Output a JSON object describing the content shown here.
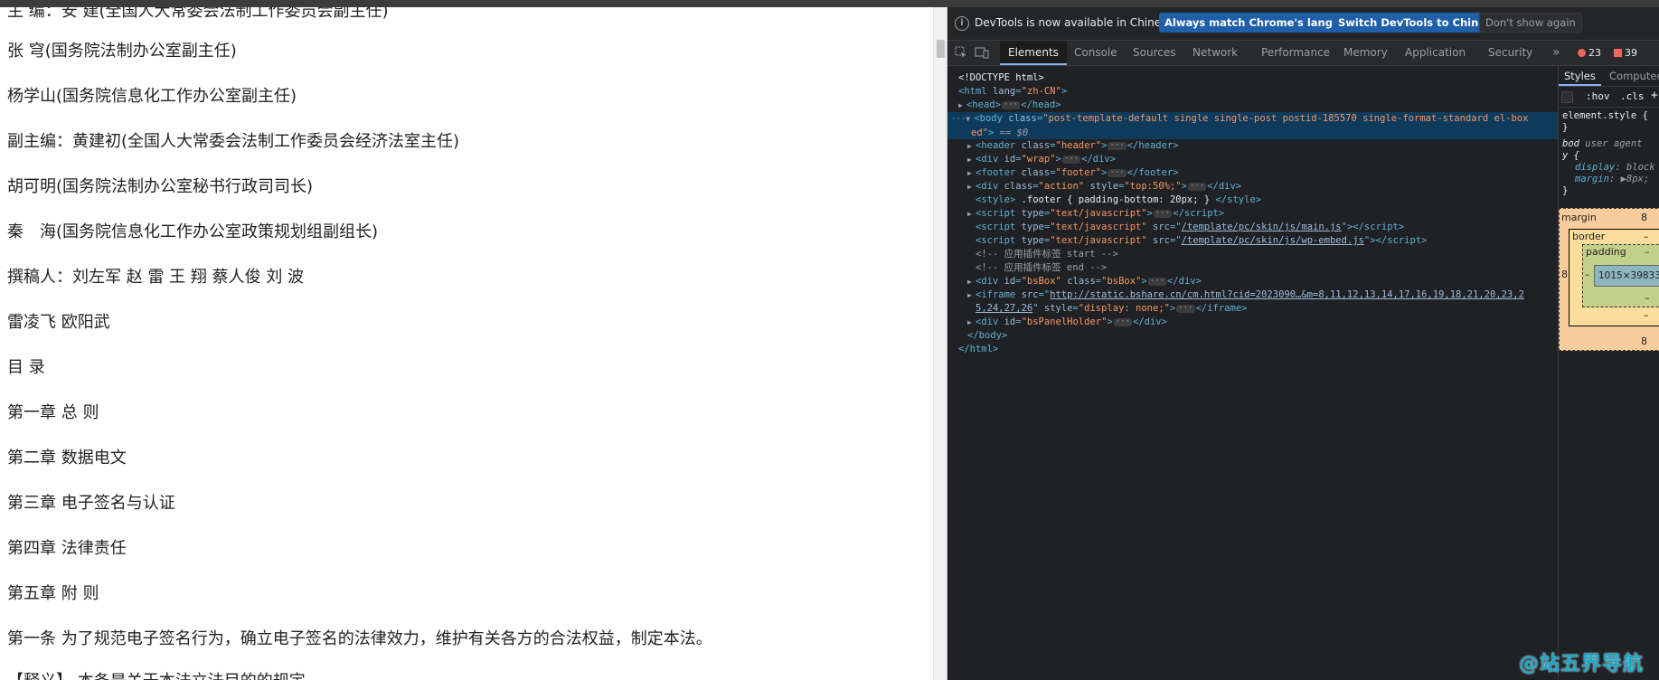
{
  "page": {
    "lines": [
      "主 编：安 建(全国人大常委会法制工作委员会副主任)",
      "张 穹(国务院法制办公室副主任)",
      "杨学山(国务院信息化工作办公室副主任)",
      "副主编：黄建初(全国人大常委会法制工作委员会经济法室主任)",
      "胡可明(国务院法制办公室秘书行政司司长)",
      "秦　海(国务院信息化工作办公室政策规划组副组长)",
      "撰稿人：刘左军 赵 雷 王 翔 蔡人俊 刘 波",
      "雷凌飞 欧阳武",
      "目 录",
      "第一章 总 则",
      "第二章 数据电文",
      "第三章 电子签名与认证",
      "第四章 法律责任",
      "第五章 附 则",
      "第一条 为了规范电子签名行为，确立电子签名的法律效力，维护有关各方的合法权益，制定本法。",
      "【释义】 本条是关于本法立法目的的规定"
    ]
  },
  "devtools": {
    "infobar": {
      "message": "DevTools is now available in Chinese!",
      "btn_match": "Always match Chrome's language",
      "btn_switch": "Switch DevTools to Chinese",
      "btn_dismiss": "Don't show again"
    },
    "tabs": [
      "Elements",
      "Console",
      "Sources",
      "Network",
      "Performance",
      "Memory",
      "Application",
      "Security"
    ],
    "more_tabs": "»",
    "errors_count": "23",
    "warnings_count": "39",
    "dom": {
      "doctype": "<!DOCTYPE html>",
      "html_open_tag": "html",
      "html_lang_attr": "lang",
      "html_lang_val": "\"zh-CN\"",
      "head": "head",
      "body_class_val": "\"post-template-default single single-post postid-185570 single-format-standard el-box",
      "body_class_val2": "ed\"",
      "selected_marker": "== $0",
      "header_class": "\"header\"",
      "wrap_id": "\"wrap\"",
      "footer_class": "\"footer\"",
      "action_class": "\"action\"",
      "action_style": "\"top:50%;\"",
      "style_text": ".footer { padding-bottom: 20px; }",
      "script_type": "\"text/javascript\"",
      "script_src1": "/template/pc/skin/js/main.js",
      "script_src2": "/template/pc/skin/js/wp-embed.js",
      "comment1": "<!-- 应用插件标签 start -->",
      "comment2": "<!-- 应用插件标签 end -->",
      "bsbox_id": "\"bsBox\"",
      "bsbox_class": "\"bsBox\"",
      "iframe_src": "http://static.bshare.cn/cm.html?cid=2023090…&m=8,11,12,13,14,17,16,19,18,21,20,23,2",
      "iframe_src2": "5,24,27,26",
      "iframe_style": "\"display: none;\"",
      "panel_id": "\"bsPanelHolder\"",
      "close_body": "</body>",
      "close_html": "</html>"
    },
    "styles": {
      "subtabs": [
        "Styles",
        "Computed"
      ],
      "hov": ":hov",
      "cls": ".cls",
      "plus": "+",
      "element_style": "element.style {",
      "close_brace": "}",
      "body_selector": "bod",
      "user_agent": "user agent",
      "y_brace": "y {",
      "prop_display": "display",
      "val_display": "block",
      "prop_margin": "margin",
      "val_margin": "8px;",
      "box_margin_label": "margin",
      "box_margin_val": "8",
      "box_border_label": "border",
      "box_dash": "–",
      "box_padding_label": "padding",
      "box_content": "1015×39833",
      "box_left_val": "8"
    }
  },
  "watermark": "@站五界导航"
}
